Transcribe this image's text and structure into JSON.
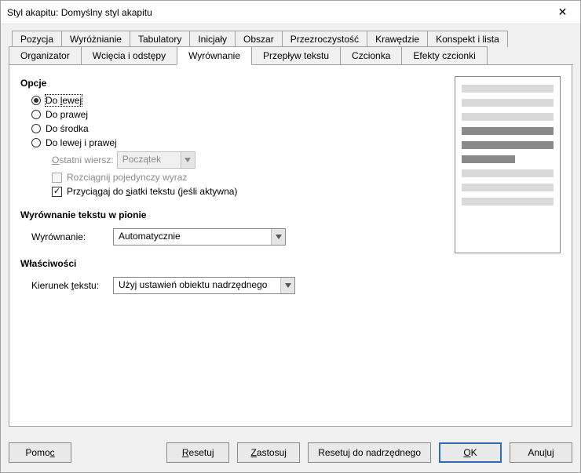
{
  "window": {
    "title": "Styl akapitu: Domyślny styl akapitu"
  },
  "tabs": {
    "upper": [
      {
        "label": "Pozycja"
      },
      {
        "label": "Wyróżnianie"
      },
      {
        "label": "Tabulatory"
      },
      {
        "label": "Inicjały"
      },
      {
        "label": "Obszar"
      },
      {
        "label": "Przezroczystość"
      },
      {
        "label": "Krawędzie"
      },
      {
        "label": "Konspekt i lista"
      }
    ],
    "lower": [
      {
        "label": "Organizator"
      },
      {
        "label": "Wcięcia i odstępy"
      },
      {
        "label": "Wyrównanie",
        "active": true
      },
      {
        "label": "Przepływ tekstu"
      },
      {
        "label": "Czcionka"
      },
      {
        "label": "Efekty czcionki"
      }
    ]
  },
  "options": {
    "title": "Opcje",
    "radios": {
      "left": "Do lewej",
      "right": "Do prawej",
      "center": "Do środka",
      "justify": "Do lewej i prawej"
    },
    "last_line_label": "Ostatni wiersz:",
    "last_line_value": "Początek",
    "expand_single": "Rozciągnij pojedynczy wyraz",
    "snap_grid": "Przyciągaj do siatki tekstu (jeśli aktywna)"
  },
  "vertical": {
    "title": "Wyrównanie tekstu w pionie",
    "label": "Wyrównanie:",
    "value": "Automatycznie"
  },
  "properties": {
    "title": "Właściwości",
    "label": "Kierunek tekstu:",
    "value": "Użyj ustawień obiektu nadrzędnego"
  },
  "buttons": {
    "help": "Pomoc",
    "reset": "Resetuj",
    "apply": "Zastosuj",
    "reset_parent": "Resetuj do nadrzędnego",
    "ok": "OK",
    "cancel": "Anuluj"
  }
}
